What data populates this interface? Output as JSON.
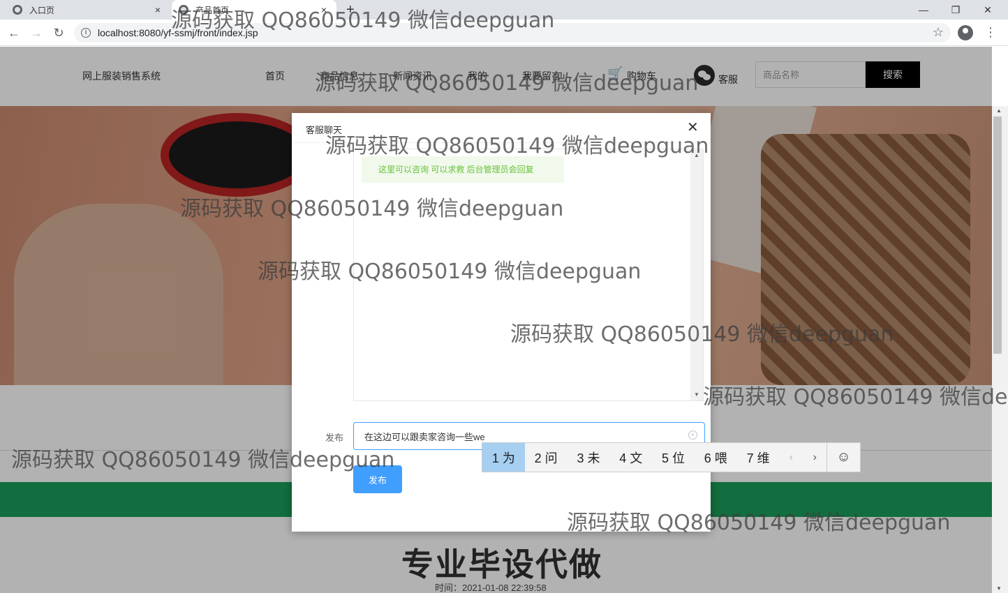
{
  "browser": {
    "tabs": [
      {
        "title": "入口页",
        "close": "×"
      },
      {
        "title": "产品首页",
        "close": "×"
      }
    ],
    "new_tab": "+",
    "window_controls": {
      "minimize": "—",
      "restore": "❐",
      "close": "✕"
    },
    "back": "←",
    "forward": "→",
    "reload": "↻",
    "url": "localhost:8080/yf-ssmj/front/index.jsp",
    "star": "☆",
    "kebab": "⋮"
  },
  "site": {
    "title": "网上服装销售系统",
    "nav": [
      "首页",
      "商品信息",
      "新闻资讯",
      "我的",
      "我要留言",
      "购物车"
    ],
    "service_label": "客服",
    "search_placeholder": "商品名称",
    "search_button": "搜索"
  },
  "article": {
    "title": "专业毕设代做",
    "time": "时间：2021-01-08 22:39:58"
  },
  "dialog": {
    "title": "客服聊天",
    "close": "✕",
    "message": "这里可以咨询 可以求救 后台管理员会回复",
    "publish_label": "发布",
    "input_value": "在这边可以跟卖家咨询一些we",
    "publish_button": "发布",
    "clear": "×"
  },
  "ime": {
    "candidates": [
      "1 为",
      "2 问",
      "3 未",
      "4 文",
      "5 位",
      "6 喂",
      "7 维"
    ],
    "prev": "‹",
    "next": "›",
    "emoji": "☺"
  },
  "watermark": "源码获取 QQ86050149 微信deepguan",
  "colors": {
    "primary": "#409eff",
    "success_text": "#67c23a",
    "success_bg": "#f0f9eb",
    "green_bar": "#1a9e5a",
    "search_button": "#000000"
  }
}
